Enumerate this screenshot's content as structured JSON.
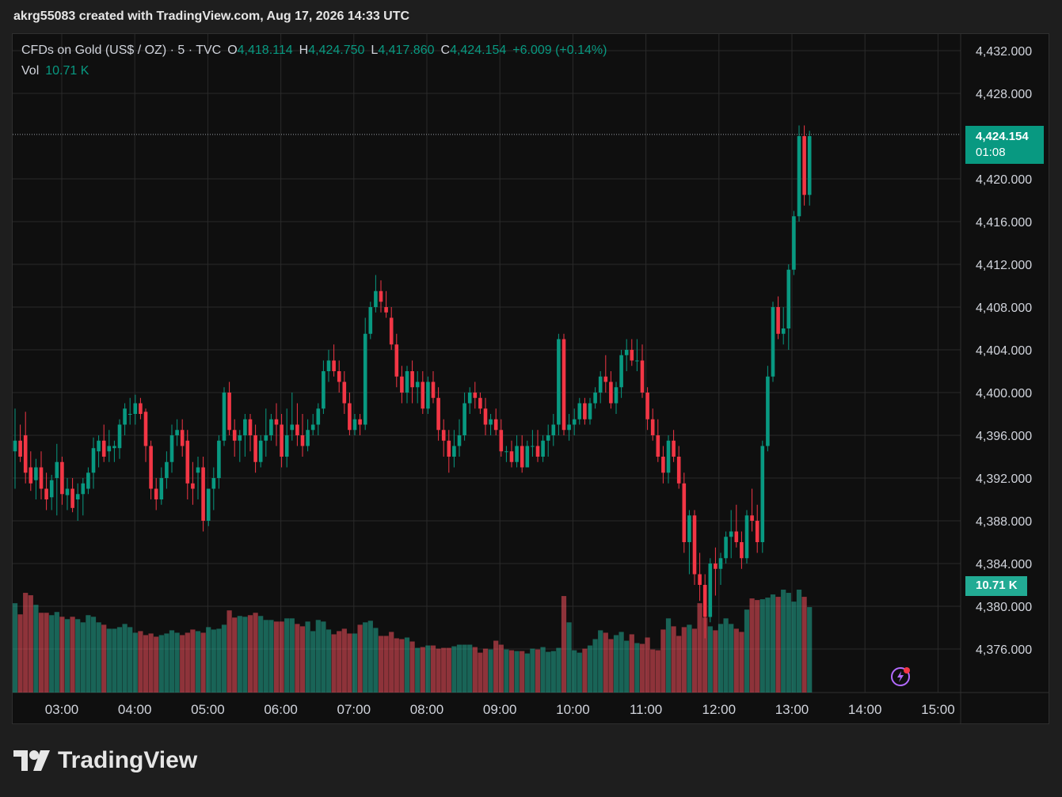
{
  "header": {
    "title": "akrg55083 created with TradingView.com, Aug 17, 2026 14:33 UTC"
  },
  "legend": {
    "symbol": "CFDs on Gold (US$ / OZ) · 5 · TVC",
    "open_label": "O",
    "open": "4,418.114",
    "high_label": "H",
    "high": "4,424.750",
    "low_label": "L",
    "low": "4,417.860",
    "close_label": "C",
    "close": "4,424.154",
    "change": "+6.009 (+0.14%)",
    "vol_label": "Vol",
    "vol": "10.71 K"
  },
  "price_badge": {
    "price": "4,424.154",
    "countdown": "01:08"
  },
  "vol_badge": {
    "value": "10.71 K"
  },
  "logo": {
    "text": "TradingView"
  },
  "colors": {
    "up": "#089981",
    "down": "#f23645",
    "vol_up": "#22ab94",
    "vol_down": "#f7525f",
    "background": "#0f0f0f",
    "grid": "#2a2a2a"
  },
  "chart_data": {
    "type": "candlestick",
    "yticks": [
      "4,432.000",
      "4,428.000",
      "4,420.000",
      "4,416.000",
      "4,412.000",
      "4,408.000",
      "4,404.000",
      "4,400.000",
      "4,396.000",
      "4,392.000",
      "4,388.000",
      "4,384.000",
      "4,380.000",
      "4,376.000"
    ],
    "ytick_values": [
      4432,
      4428,
      4420,
      4416,
      4412,
      4408,
      4404,
      4400,
      4396,
      4392,
      4388,
      4384,
      4380,
      4376
    ],
    "xticks": [
      "03:00",
      "04:00",
      "05:00",
      "06:00",
      "07:00",
      "08:00",
      "09:00",
      "10:00",
      "11:00",
      "12:00",
      "13:00",
      "14:00",
      "15:00"
    ],
    "ylim": [
      4372.5,
      4433.5
    ],
    "last_price": 4424.154,
    "candles_ohlcv": [
      [
        4394.5,
        4398.5,
        4391.0,
        4395.5,
        11.2
      ],
      [
        4395.5,
        4397.0,
        4393.5,
        4394.0,
        9.8
      ],
      [
        4396.0,
        4398.2,
        4391.5,
        4392.5,
        12.5
      ],
      [
        4393.0,
        4394.5,
        4390.8,
        4391.5,
        12.2
      ],
      [
        4391.8,
        4393.8,
        4390.0,
        4393.0,
        11.0
      ],
      [
        4393.0,
        4394.5,
        4390.0,
        4391.0,
        10.0
      ],
      [
        4391.0,
        4392.5,
        4389.0,
        4390.0,
        10.0
      ],
      [
        4390.2,
        4392.3,
        4389.0,
        4391.8,
        9.7
      ],
      [
        4392.0,
        4395.2,
        4388.5,
        4393.5,
        10.1
      ],
      [
        4393.5,
        4394.0,
        4389.5,
        4390.5,
        9.5
      ],
      [
        4390.4,
        4392.0,
        4389.0,
        4391.0,
        9.2
      ],
      [
        4391.0,
        4392.0,
        4388.8,
        4389.2,
        9.5
      ],
      [
        4390.0,
        4391.5,
        4388.0,
        4390.5,
        9.2
      ],
      [
        4390.5,
        4392.0,
        4388.5,
        4391.5,
        8.8
      ],
      [
        4391.0,
        4393.0,
        4390.5,
        4392.5,
        9.7
      ],
      [
        4392.5,
        4395.8,
        4391.0,
        4394.8,
        9.5
      ],
      [
        4394.5,
        4396.0,
        4393.0,
        4395.5,
        8.8
      ],
      [
        4395.5,
        4397.0,
        4393.5,
        4394.0,
        8.5
      ],
      [
        4394.5,
        4396.5,
        4393.5,
        4395.0,
        8.0
      ],
      [
        4394.8,
        4395.5,
        4393.5,
        4395.0,
        8.0
      ],
      [
        4394.8,
        4397.5,
        4393.8,
        4397.0,
        8.2
      ],
      [
        4397.0,
        4399.0,
        4396.0,
        4398.5,
        8.6
      ],
      [
        4398.0,
        4399.5,
        4397.0,
        4398.0,
        8.2
      ],
      [
        4398.0,
        4399.8,
        4397.0,
        4399.0,
        7.5
      ],
      [
        4399.0,
        4399.5,
        4397.5,
        4398.0,
        7.7
      ],
      [
        4398.2,
        4398.5,
        4393.5,
        4395.0,
        7.2
      ],
      [
        4395.0,
        4395.5,
        4390.0,
        4391.0,
        7.4
      ],
      [
        4391.0,
        4392.0,
        4389.0,
        4390.0,
        7.0
      ],
      [
        4390.0,
        4393.0,
        4389.5,
        4392.0,
        7.2
      ],
      [
        4392.0,
        4394.5,
        4391.0,
        4393.5,
        7.4
      ],
      [
        4393.5,
        4397.0,
        4392.5,
        4396.0,
        7.8
      ],
      [
        4396.0,
        4397.5,
        4395.0,
        4396.5,
        7.5
      ],
      [
        4396.5,
        4397.5,
        4394.0,
        4395.0,
        7.2
      ],
      [
        4395.5,
        4396.5,
        4390.0,
        4391.5,
        7.5
      ],
      [
        4391.5,
        4393.5,
        4389.5,
        4391.0,
        7.9
      ],
      [
        4392.5,
        4394.0,
        4390.0,
        4393.0,
        7.7
      ],
      [
        4393.0,
        4394.0,
        4387.0,
        4388.0,
        7.5
      ],
      [
        4388.0,
        4391.0,
        4387.5,
        4391.0,
        8.2
      ],
      [
        4391.0,
        4393.0,
        4389.0,
        4392.0,
        7.9
      ],
      [
        4392.0,
        4396.0,
        4391.0,
        4395.5,
        8.0
      ],
      [
        4395.5,
        4400.5,
        4395.0,
        4400.0,
        8.5
      ],
      [
        4400.0,
        4401.0,
        4396.0,
        4396.5,
        10.3
      ],
      [
        4396.5,
        4397.5,
        4394.0,
        4395.5,
        9.4
      ],
      [
        4395.5,
        4396.5,
        4393.5,
        4396.0,
        9.6
      ],
      [
        4396.0,
        4398.0,
        4394.0,
        4397.5,
        9.5
      ],
      [
        4397.5,
        4398.0,
        4394.5,
        4396.0,
        9.7
      ],
      [
        4396.0,
        4397.0,
        4392.5,
        4393.5,
        10.0
      ],
      [
        4393.5,
        4396.0,
        4393.0,
        4395.5,
        9.6
      ],
      [
        4395.5,
        4398.5,
        4394.0,
        4396.0,
        9.1
      ],
      [
        4396.0,
        4398.0,
        4395.5,
        4397.5,
        9.1
      ],
      [
        4397.5,
        4399.0,
        4395.0,
        4397.0,
        8.9
      ],
      [
        4397.0,
        4398.0,
        4393.0,
        4394.0,
        8.9
      ],
      [
        4394.0,
        4398.5,
        4393.0,
        4396.0,
        9.3
      ],
      [
        4396.5,
        4400.0,
        4395.5,
        4397.0,
        9.3
      ],
      [
        4397.0,
        4399.0,
        4395.0,
        4396.0,
        8.6
      ],
      [
        4396.0,
        4398.0,
        4394.0,
        4395.0,
        8.3
      ],
      [
        4395.0,
        4397.5,
        4394.5,
        4396.5,
        8.9
      ],
      [
        4396.5,
        4398.0,
        4396.0,
        4397.0,
        7.7
      ],
      [
        4397.0,
        4399.0,
        4396.0,
        4398.5,
        9.1
      ],
      [
        4398.5,
        4403.0,
        4398.0,
        4402.0,
        8.9
      ],
      [
        4402.0,
        4404.0,
        4401.0,
        4403.0,
        7.9
      ],
      [
        4403.0,
        4404.5,
        4401.5,
        4402.0,
        7.3
      ],
      [
        4402.0,
        4403.0,
        4400.0,
        4401.0,
        7.7
      ],
      [
        4401.0,
        4402.0,
        4398.0,
        4399.0,
        8.0
      ],
      [
        4399.0,
        4400.0,
        4396.0,
        4396.5,
        7.4
      ],
      [
        4396.5,
        4398.0,
        4396.0,
        4397.5,
        7.4
      ],
      [
        4397.5,
        4398.0,
        4396.0,
        4397.0,
        8.5
      ],
      [
        4397.0,
        4407.0,
        4396.5,
        4405.5,
        8.8
      ],
      [
        4405.5,
        4408.5,
        4405.0,
        4408.0,
        9.0
      ],
      [
        4408.0,
        4411.0,
        4407.5,
        4409.5,
        8.1
      ],
      [
        4409.5,
        4410.5,
        4407.5,
        4408.5,
        7.1
      ],
      [
        4408.0,
        4409.5,
        4407.0,
        4407.5,
        7.1
      ],
      [
        4407.0,
        4408.0,
        4404.0,
        4404.5,
        7.6
      ],
      [
        4404.5,
        4405.5,
        4400.5,
        4401.5,
        6.8
      ],
      [
        4401.5,
        4402.5,
        4399.0,
        4400.0,
        6.7
      ],
      [
        4400.0,
        4402.5,
        4399.0,
        4402.0,
        6.9
      ],
      [
        4402.0,
        4403.0,
        4399.0,
        4400.5,
        6.4
      ],
      [
        4400.5,
        4402.0,
        4399.0,
        4401.0,
        5.6
      ],
      [
        4401.0,
        4402.0,
        4398.0,
        4398.5,
        5.7
      ],
      [
        4398.5,
        4401.5,
        4398.0,
        4401.0,
        5.9
      ],
      [
        4401.0,
        4402.0,
        4399.0,
        4399.5,
        5.9
      ],
      [
        4399.5,
        4400.5,
        4395.5,
        4396.5,
        5.5
      ],
      [
        4396.5,
        4397.5,
        4394.0,
        4395.5,
        5.6
      ],
      [
        4395.5,
        4396.5,
        4392.5,
        4394.0,
        5.6
      ],
      [
        4394.0,
        4396.5,
        4393.0,
        4395.0,
        5.8
      ],
      [
        4395.0,
        4397.5,
        4394.0,
        4396.0,
        6.0
      ],
      [
        4396.0,
        4400.0,
        4395.5,
        4399.0,
        6.0
      ],
      [
        4399.0,
        4400.5,
        4398.0,
        4400.0,
        6.0
      ],
      [
        4400.0,
        4401.0,
        4398.5,
        4399.5,
        5.7
      ],
      [
        4399.5,
        4400.0,
        4398.0,
        4398.5,
        5.0
      ],
      [
        4398.5,
        4399.5,
        4396.0,
        4397.0,
        5.5
      ],
      [
        4397.0,
        4398.0,
        4396.0,
        4397.5,
        5.4
      ],
      [
        4397.5,
        4398.5,
        4396.0,
        4396.5,
        6.5
      ],
      [
        4396.5,
        4397.5,
        4394.0,
        4394.5,
        6.0
      ],
      [
        4394.5,
        4395.0,
        4393.5,
        4394.5,
        5.4
      ],
      [
        4394.5,
        4395.5,
        4393.0,
        4393.5,
        5.3
      ],
      [
        4393.5,
        4396.0,
        4393.0,
        4395.0,
        5.2
      ],
      [
        4395.0,
        4396.0,
        4392.5,
        4393.0,
        5.2
      ],
      [
        4393.0,
        4395.5,
        4393.0,
        4395.0,
        4.9
      ],
      [
        4395.0,
        4396.5,
        4394.0,
        4395.0,
        5.5
      ],
      [
        4395.0,
        4396.5,
        4393.5,
        4394.0,
        5.4
      ],
      [
        4394.0,
        4396.0,
        4393.5,
        4395.5,
        5.7
      ],
      [
        4395.5,
        4397.0,
        4394.0,
        4396.0,
        5.1
      ],
      [
        4396.0,
        4398.0,
        4395.0,
        4397.0,
        5.2
      ],
      [
        4397.0,
        4405.5,
        4396.0,
        4405.0,
        5.6
      ],
      [
        4405.0,
        4405.5,
        4396.0,
        4396.5,
        12.1
      ],
      [
        4396.5,
        4398.0,
        4395.5,
        4397.0,
        8.8
      ],
      [
        4397.0,
        4398.5,
        4396.0,
        4397.5,
        5.3
      ],
      [
        4397.5,
        4399.5,
        4397.0,
        4399.0,
        5.0
      ],
      [
        4399.0,
        4399.5,
        4397.0,
        4397.5,
        5.5
      ],
      [
        4397.5,
        4399.5,
        4397.0,
        4399.0,
        5.9
      ],
      [
        4399.0,
        4400.5,
        4398.5,
        4400.0,
        6.7
      ],
      [
        4400.0,
        4402.0,
        4399.0,
        4401.5,
        7.8
      ],
      [
        4401.5,
        4403.5,
        4400.0,
        4401.0,
        7.5
      ],
      [
        4401.0,
        4402.0,
        4398.5,
        4399.0,
        6.7
      ],
      [
        4399.0,
        4401.0,
        4398.0,
        4400.5,
        7.2
      ],
      [
        4400.5,
        4404.0,
        4399.5,
        4403.5,
        7.6
      ],
      [
        4403.5,
        4405.0,
        4402.0,
        4404.0,
        6.5
      ],
      [
        4404.0,
        4405.0,
        4402.5,
        4403.0,
        7.3
      ],
      [
        4403.0,
        4405.0,
        4402.0,
        4403.0,
        6.2
      ],
      [
        4403.0,
        4404.5,
        4399.5,
        4400.0,
        6.1
      ],
      [
        4400.0,
        4400.5,
        4396.5,
        4397.5,
        6.9
      ],
      [
        4397.5,
        4398.5,
        4395.5,
        4396.0,
        5.4
      ],
      [
        4396.0,
        4397.5,
        4393.5,
        4394.0,
        5.3
      ],
      [
        4394.0,
        4395.0,
        4391.5,
        4392.5,
        7.9
      ],
      [
        4392.5,
        4396.0,
        4391.5,
        4395.5,
        9.3
      ],
      [
        4395.5,
        4396.5,
        4393.5,
        4394.0,
        8.3
      ],
      [
        4394.0,
        4395.0,
        4391.0,
        4391.5,
        7.1
      ],
      [
        4391.5,
        4392.5,
        4385.0,
        4386.0,
        8.2
      ],
      [
        4386.0,
        4389.0,
        4383.0,
        4388.5,
        8.5
      ],
      [
        4388.5,
        4389.0,
        4382.0,
        4383.0,
        8.0
      ],
      [
        4383.0,
        4385.0,
        4380.5,
        4382.0,
        11.2
      ],
      [
        4382.0,
        4383.0,
        4377.0,
        4379.0,
        9.4
      ],
      [
        4379.0,
        4384.5,
        4378.5,
        4384.0,
        8.3
      ],
      [
        4384.0,
        4385.5,
        4381.0,
        4383.5,
        7.8
      ],
      [
        4383.5,
        4385.0,
        4382.0,
        4384.5,
        8.6
      ],
      [
        4384.5,
        4387.0,
        4384.0,
        4386.5,
        9.3
      ],
      [
        4386.5,
        4389.0,
        4384.5,
        4387.0,
        8.6
      ],
      [
        4387.0,
        4389.5,
        4385.5,
        4386.0,
        8.0
      ],
      [
        4386.0,
        4387.0,
        4383.5,
        4384.5,
        7.6
      ],
      [
        4384.5,
        4389.0,
        4384.0,
        4388.5,
        10.4
      ],
      [
        4388.5,
        4391.0,
        4387.0,
        4388.0,
        11.8
      ],
      [
        4388.0,
        4389.5,
        4385.0,
        4386.0,
        11.6
      ],
      [
        4386.0,
        4395.5,
        4385.0,
        4395.0,
        11.7
      ],
      [
        4395.0,
        4402.5,
        4394.5,
        4401.5,
        11.9
      ],
      [
        4401.5,
        4408.5,
        4401.0,
        4408.0,
        12.3
      ],
      [
        4408.0,
        4409.0,
        4405.0,
        4405.5,
        12.0
      ],
      [
        4405.5,
        4408.0,
        4404.5,
        4406.0,
        12.9
      ],
      [
        4406.0,
        4412.0,
        4404.0,
        4411.5,
        12.5
      ],
      [
        4411.5,
        4417.0,
        4411.0,
        4416.5,
        11.4
      ],
      [
        4416.5,
        4425.0,
        4416.0,
        4424.0,
        12.9
      ],
      [
        4424.0,
        4425.0,
        4417.5,
        4418.5,
        12.0
      ],
      [
        4418.5,
        4424.5,
        4417.5,
        4424.0,
        10.71
      ]
    ]
  }
}
